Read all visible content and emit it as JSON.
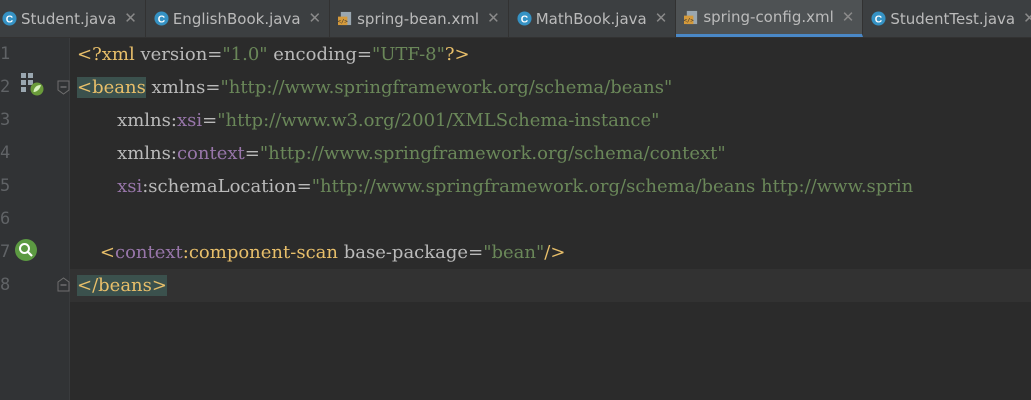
{
  "tabs": [
    {
      "label": "Student.java",
      "icon": "class-icon",
      "active": false
    },
    {
      "label": "EnglishBook.java",
      "icon": "class-icon",
      "active": false
    },
    {
      "label": "spring-bean.xml",
      "icon": "xml-icon",
      "active": false
    },
    {
      "label": "MathBook.java",
      "icon": "class-icon",
      "active": false
    },
    {
      "label": "spring-config.xml",
      "icon": "xml-icon",
      "active": true
    },
    {
      "label": "StudentTest.java",
      "icon": "class-icon",
      "active": false
    }
  ],
  "close_glyph": "✕",
  "line_numbers": [
    "1",
    "2",
    "3",
    "4",
    "5",
    "6",
    "7",
    "8"
  ],
  "code": {
    "l1": {
      "p1": "<?xml ",
      "p2": "version",
      "p3": "=",
      "p4": "\"1.0\"",
      "p5": " encoding",
      "p6": "=",
      "p7": "\"UTF-8\"",
      "p8": "?>"
    },
    "l2": {
      "p1": "<beans",
      "p2": " xmlns",
      "p3": "=",
      "p4": "\"http://www.springframework.org/schema/beans\""
    },
    "l3": {
      "indent": "       ",
      "p1": "xmlns",
      "p2": ":",
      "p3": "xsi",
      "p4": "=",
      "p5": "\"http://www.w3.org/2001/XMLSchema-instance\""
    },
    "l4": {
      "indent": "       ",
      "p1": "xmlns",
      "p2": ":",
      "p3": "context",
      "p4": "=",
      "p5": "\"http://www.springframework.org/schema/context\""
    },
    "l5": {
      "indent": "       ",
      "p1": "xsi",
      "p2": ":schemaLocation",
      "p3": "=",
      "p4": "\"http://www.springframework.org/schema/beans http://www.sprin"
    },
    "l7": {
      "indent": "    ",
      "p1": "<",
      "p2": "context",
      "p3": ":component-scan",
      "p4": " base-package",
      "p5": "=",
      "p6": "\"bean\"",
      "p7": "/>"
    },
    "l8": {
      "p1": "</beans>"
    }
  },
  "colors": {
    "tag": "#e8bf6a",
    "attribute": "#bababa",
    "value": "#6a8759",
    "namespace": "#9876aa",
    "active_tab_underline": "#4a88c7"
  }
}
